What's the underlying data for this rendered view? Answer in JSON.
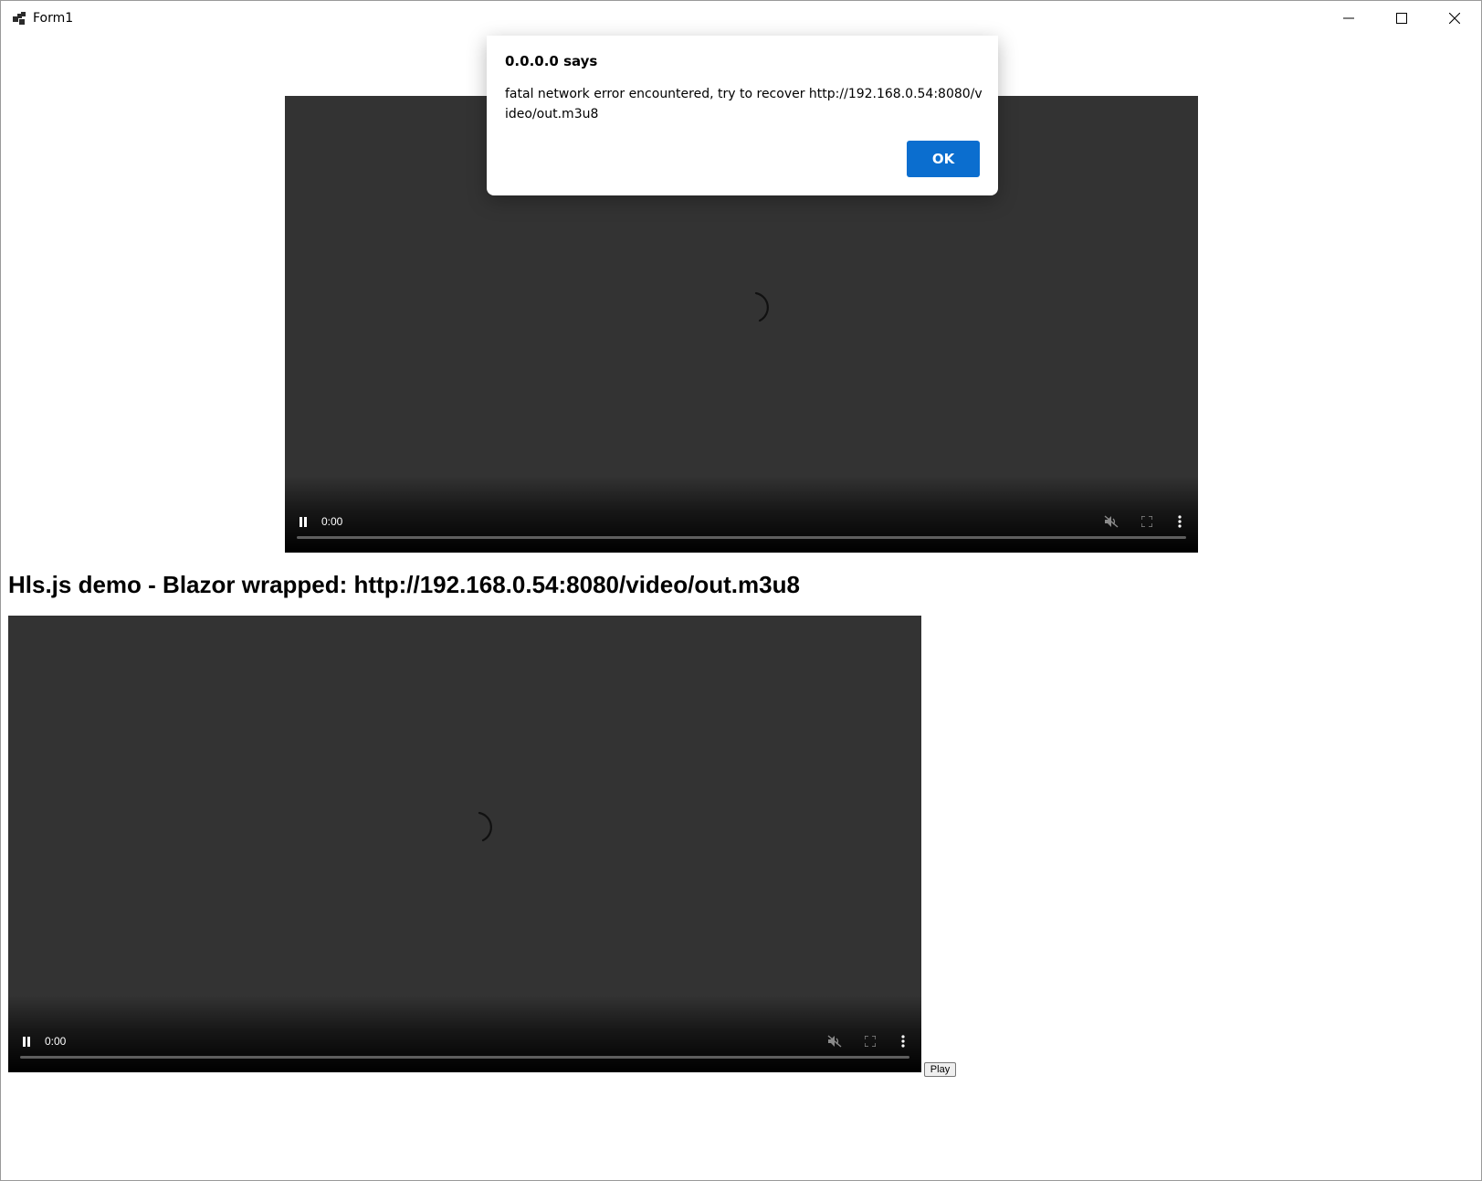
{
  "window": {
    "title": "Form1",
    "app_icon": "form-app-icon",
    "controls": [
      "minimize-icon",
      "maximize-icon",
      "close-icon"
    ]
  },
  "videos": [
    {
      "time": "0:00",
      "icons": [
        "loading-spinner-icon",
        "pause-icon",
        "mute-icon",
        "fullscreen-icon",
        "more-options-icon"
      ],
      "progress": 0
    },
    {
      "time": "0:00",
      "icons": [
        "loading-spinner-icon",
        "pause-icon",
        "mute-icon",
        "fullscreen-icon",
        "more-options-icon"
      ],
      "progress": 0
    }
  ],
  "page": {
    "heading": "Hls.js demo - Blazor wrapped: http://192.168.0.54:8080/video/out.m3u8",
    "play_button": "Play"
  },
  "dialog": {
    "title": "0.0.0.0 says",
    "message": "fatal network error encountered, try to recover http://192.168.0.54:8080/video/out.m3u8",
    "ok_label": "OK",
    "ok_color": "#0b6ecf"
  }
}
